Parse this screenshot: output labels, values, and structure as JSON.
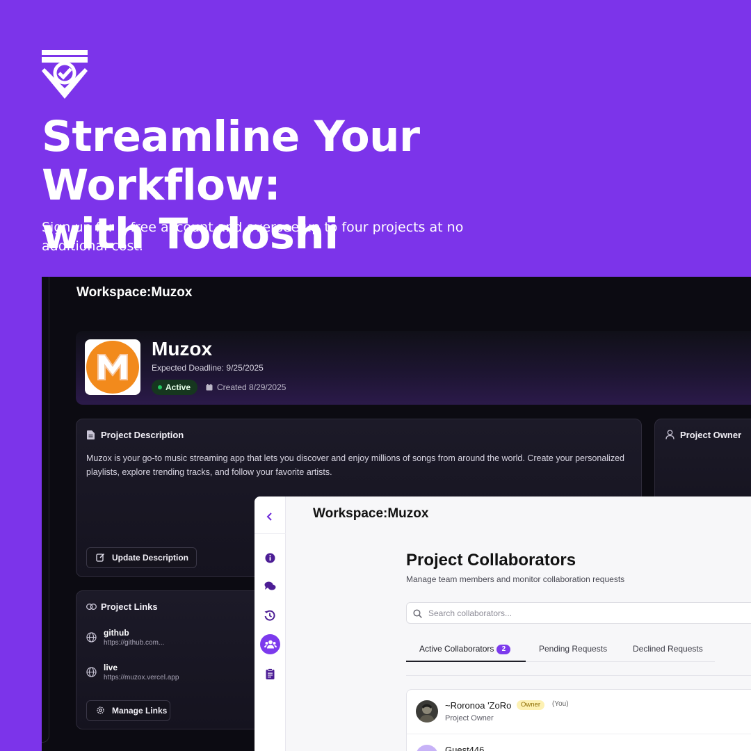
{
  "hero": {
    "headline_line1": "Streamline Your Workflow:",
    "headline_line2": "with Todoshi",
    "subheadline": "Sign up for a free account and oversee up to four projects at no additional cost."
  },
  "dark_view": {
    "workspace_title": "Workspace:Muzox",
    "project": {
      "name": "Muzox",
      "deadline": "Expected Deadline: 9/25/2025",
      "status": "Active",
      "created": "Created 8/29/2025"
    },
    "description_card": {
      "title": "Project Description",
      "text": "Muzox is your go-to music streaming app that lets you discover and enjoy millions of songs from around the world. Create your personalized playlists, explore trending tracks, and follow your favorite artists.",
      "button": "Update Description"
    },
    "links_card": {
      "title": "Project Links",
      "links": [
        {
          "name": "github",
          "url": "https://github.com..."
        },
        {
          "name": "live",
          "url": "https://muzox.vercel.app"
        }
      ],
      "button": "Manage Links"
    },
    "owner_card": {
      "title": "Project Owner"
    }
  },
  "light_view": {
    "workspace_title": "Workspace:Muzox",
    "title": "Project Collaborators",
    "subtitle": "Manage team members and monitor collaboration requests",
    "search_placeholder": "Search collaborators...",
    "tabs": [
      {
        "label": "Active Collaborators",
        "count": "2"
      },
      {
        "label": "Pending Requests"
      },
      {
        "label": "Declined Requests"
      }
    ],
    "collaborators": [
      {
        "name": "~Roronoa 'ZoRo",
        "badge": "Owner",
        "you": "(You)",
        "role": "Project Owner"
      },
      {
        "name": "Guest446"
      }
    ]
  },
  "colors": {
    "brand_purple": "#7c34ea",
    "accent_violet": "#7c3aed",
    "active_green": "#22c55e"
  }
}
